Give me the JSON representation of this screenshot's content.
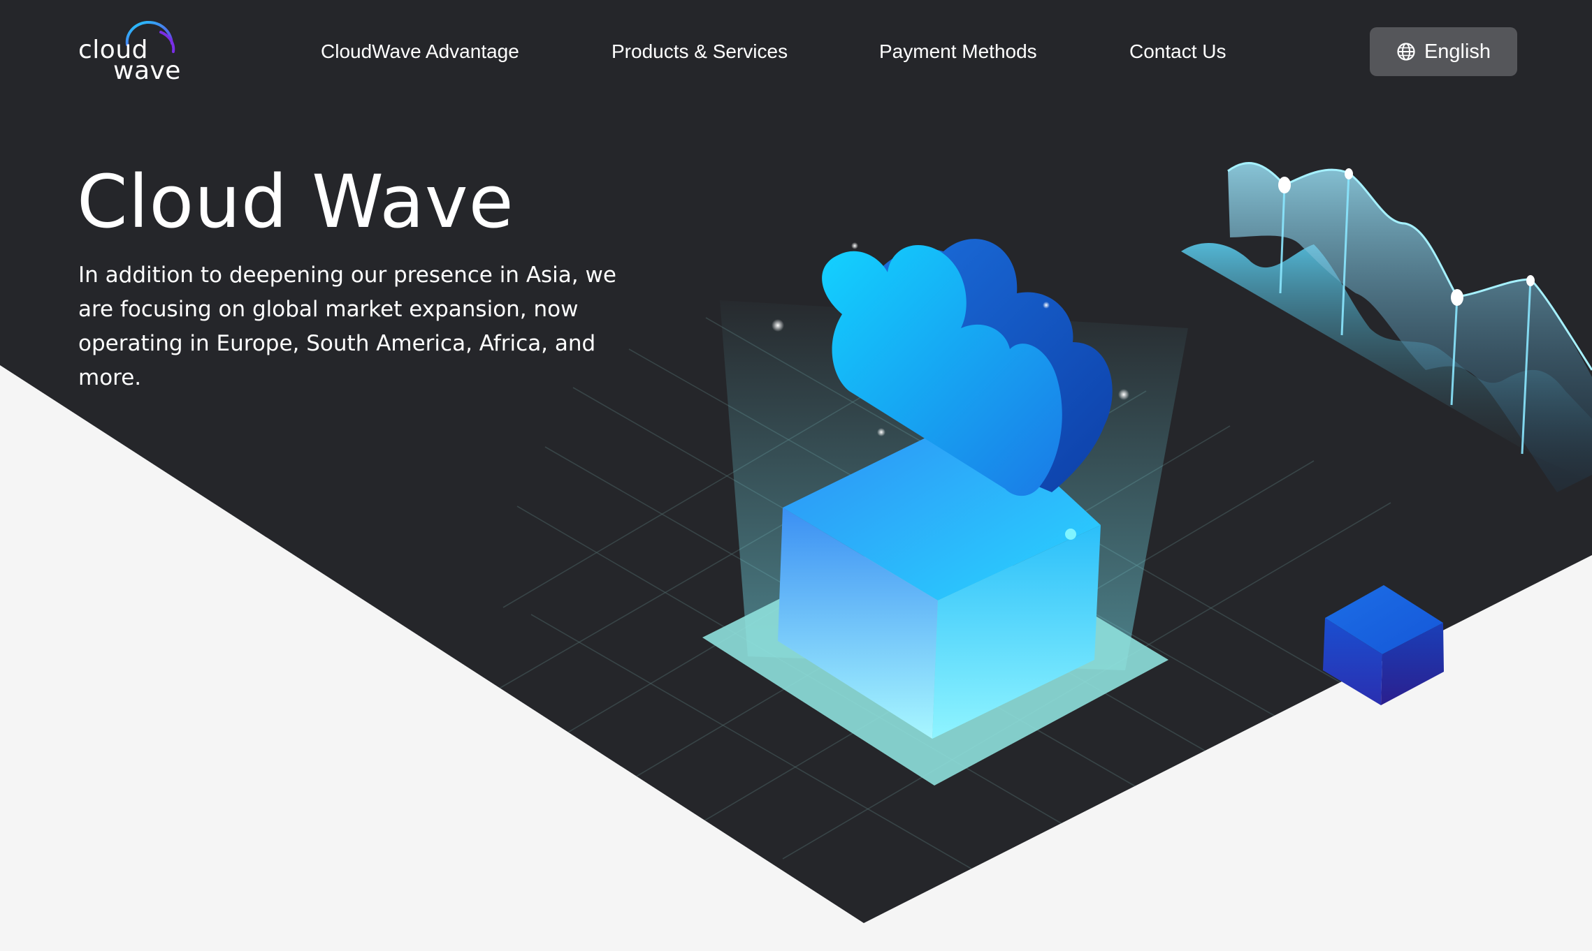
{
  "brand": {
    "logo_line1": "cloud",
    "logo_line2": "wave"
  },
  "nav": {
    "items": [
      {
        "label": "CloudWave Advantage"
      },
      {
        "label": "Products & Services"
      },
      {
        "label": "Payment Methods"
      },
      {
        "label": "Contact Us"
      }
    ]
  },
  "language": {
    "label": "English",
    "icon": "globe-icon"
  },
  "hero": {
    "title": "Cloud Wave",
    "description": "In addition to deepening our presence in Asia, we are focusing on global market expansion, now operating in Europe, South America, Africa, and more."
  },
  "colors": {
    "dark_background": "#25262a",
    "light_background": "#f5f5f5",
    "accent_cyan": "#19c8f5",
    "accent_blue": "#1a5be0",
    "language_button": "#55565a"
  },
  "icons": {
    "logo": "cloud-logo-icon",
    "illustration": "cloud-server-illustration"
  }
}
